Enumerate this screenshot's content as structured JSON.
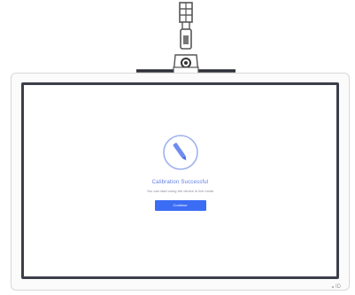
{
  "calibration": {
    "title": "Calibration Successful",
    "subtitle": "You can start using the device in live mode",
    "continue_label": "Continue",
    "icon": "pen-tip-icon",
    "accent_color": "#3b6cf4"
  },
  "device": {
    "corner_label": "ID",
    "camera_icon": "document-camera-icon"
  }
}
